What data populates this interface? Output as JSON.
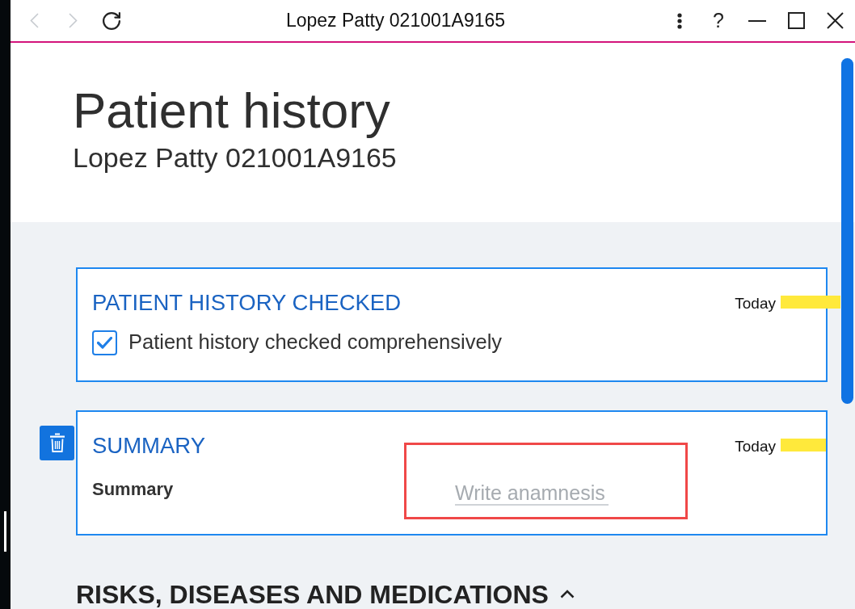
{
  "window": {
    "title": "Lopez Patty 021001A9165",
    "nav_buttons": [
      {
        "kind": "back",
        "disabled": true
      },
      {
        "kind": "forward",
        "disabled": true
      },
      {
        "kind": "reload",
        "disabled": false
      }
    ],
    "window_buttons": [
      {
        "kind": "more"
      },
      {
        "kind": "help",
        "label": "?"
      },
      {
        "kind": "minimize"
      },
      {
        "kind": "maximize"
      },
      {
        "kind": "close"
      }
    ]
  },
  "header": {
    "title": "Patient history",
    "subtitle": "Lopez Patty 021001A9165"
  },
  "cards": [
    {
      "kind": "checkbox",
      "title": "PATIENT HISTORY CHECKED",
      "date": "Today",
      "deletable": false,
      "checkbox": {
        "label": "Patient history checked comprehensively",
        "checked": true
      }
    },
    {
      "kind": "text",
      "title": "SUMMARY",
      "date": "Today",
      "deletable": true,
      "field": {
        "label": "Summary",
        "placeholder": "Write anamnesis",
        "highlighted": true
      }
    }
  ],
  "section": {
    "title": "RISKS, DISEASES AND MEDICATIONS",
    "expanded": true
  }
}
